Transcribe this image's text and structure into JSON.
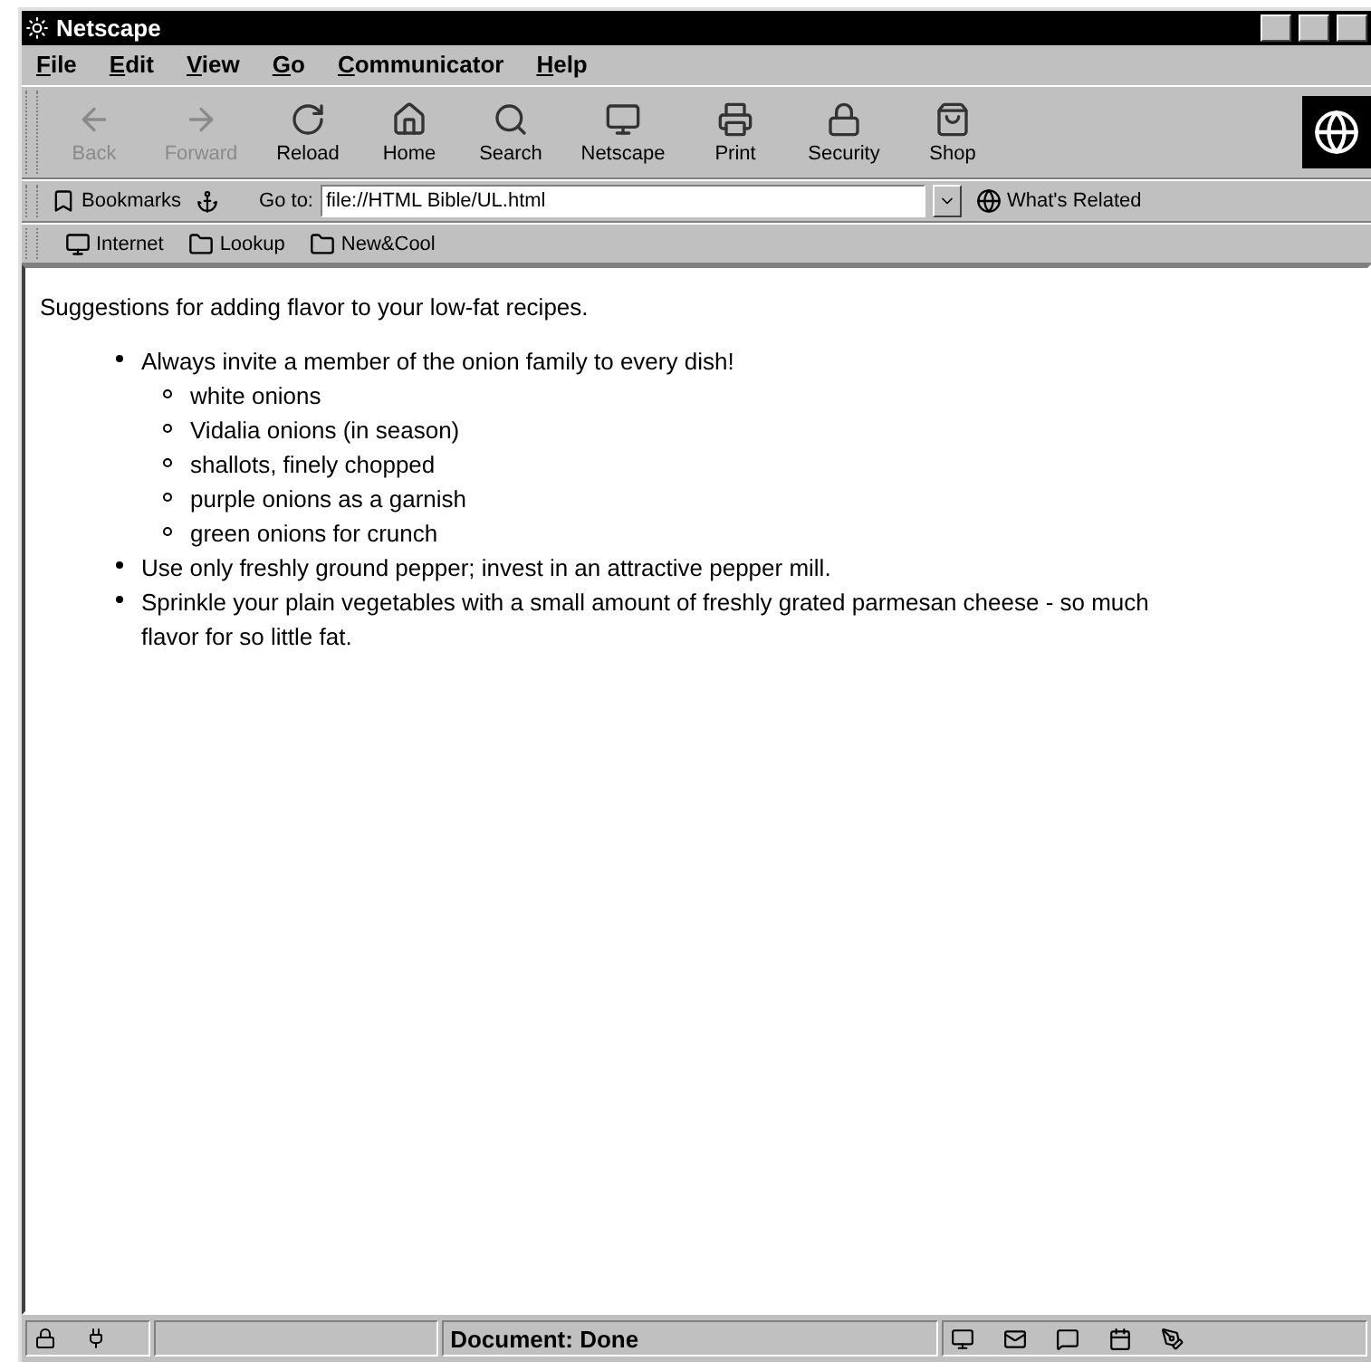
{
  "window": {
    "title": "Netscape"
  },
  "menu": [
    {
      "label": "File"
    },
    {
      "label": "Edit"
    },
    {
      "label": "View"
    },
    {
      "label": "Go"
    },
    {
      "label": "Communicator"
    },
    {
      "label": "Help"
    }
  ],
  "toolbar": [
    {
      "label": "Back",
      "disabled": true
    },
    {
      "label": "Forward",
      "disabled": true
    },
    {
      "label": "Reload",
      "disabled": false
    },
    {
      "label": "Home",
      "disabled": false
    },
    {
      "label": "Search",
      "disabled": false
    },
    {
      "label": "Netscape",
      "disabled": false
    },
    {
      "label": "Print",
      "disabled": false
    },
    {
      "label": "Security",
      "disabled": false
    },
    {
      "label": "Shop",
      "disabled": false
    }
  ],
  "location_bar": {
    "bookmarks": "Bookmarks",
    "goto_label": "Go to:",
    "url": "file://HTML Bible/UL.html",
    "related": "What's Related"
  },
  "personal_toolbar": [
    {
      "label": "Internet"
    },
    {
      "label": "Lookup"
    },
    {
      "label": "New&Cool"
    }
  ],
  "content": {
    "intro": "Suggestions for adding flavor to your low-fat recipes.",
    "items": [
      {
        "text": "Always invite a member of the onion family to every dish!",
        "children": [
          {
            "text": "white onions"
          },
          {
            "text": "Vidalia onions (in season)"
          },
          {
            "text": "shallots, finely chopped"
          },
          {
            "text": "purple onions as a garnish"
          },
          {
            "text": "green onions for crunch"
          }
        ]
      },
      {
        "text": "Use only freshly ground pepper; invest in an attractive pepper mill."
      },
      {
        "text": "Sprinkle your plain vegetables with a small amount of freshly grated parmesan cheese - so much flavor for so little fat."
      }
    ]
  },
  "status_bar": {
    "text": "Document: Done"
  }
}
